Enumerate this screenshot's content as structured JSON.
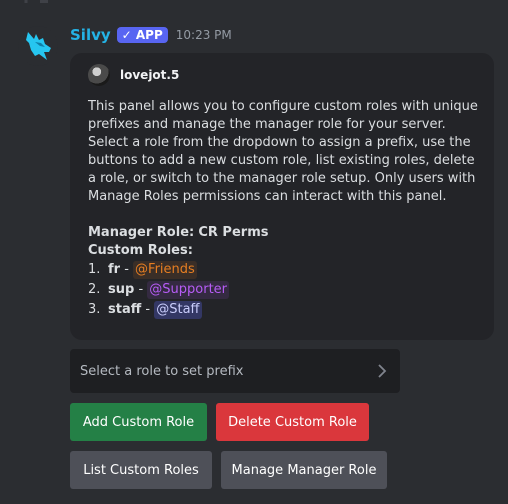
{
  "message": {
    "author": "Silvy",
    "badge": "✓ APP",
    "timestamp": "10:23 PM"
  },
  "embed": {
    "author_name": "lovejot.5",
    "description": "This panel allows you to configure custom roles with unique prefixes and manage the manager role for your server. Select a role from the dropdown to assign a prefix, use the buttons to add a new custom role, list existing roles, delete a role, or switch to the manager role setup. Only users with Manage Roles permissions can interact with this panel.",
    "manager_role_label": "Manager Role:",
    "manager_role_value": "CR Perms",
    "custom_roles_label": "Custom Roles:",
    "custom_roles": [
      {
        "num": "1.",
        "name": "fr",
        "sep": " - ",
        "mention": "@Friends"
      },
      {
        "num": "2.",
        "name": "sup",
        "sep": " - ",
        "mention": "@Supporter"
      },
      {
        "num": "3.",
        "name": "staff",
        "sep": " - ",
        "mention": "@Staff"
      }
    ]
  },
  "components": {
    "select_placeholder": "Select a role to set prefix",
    "add_label": "Add Custom Role",
    "delete_label": "Delete Custom Role",
    "list_label": "List Custom Roles",
    "manage_label": "Manage Manager Role"
  },
  "colors": {
    "username": "#24b3e6",
    "badge": "#5865f2",
    "friends": "#e67e22",
    "supporter": "#b65cf5",
    "staff": "#c9cdfb",
    "success": "#248046",
    "danger": "#da373c",
    "secondary": "#4e5058"
  }
}
